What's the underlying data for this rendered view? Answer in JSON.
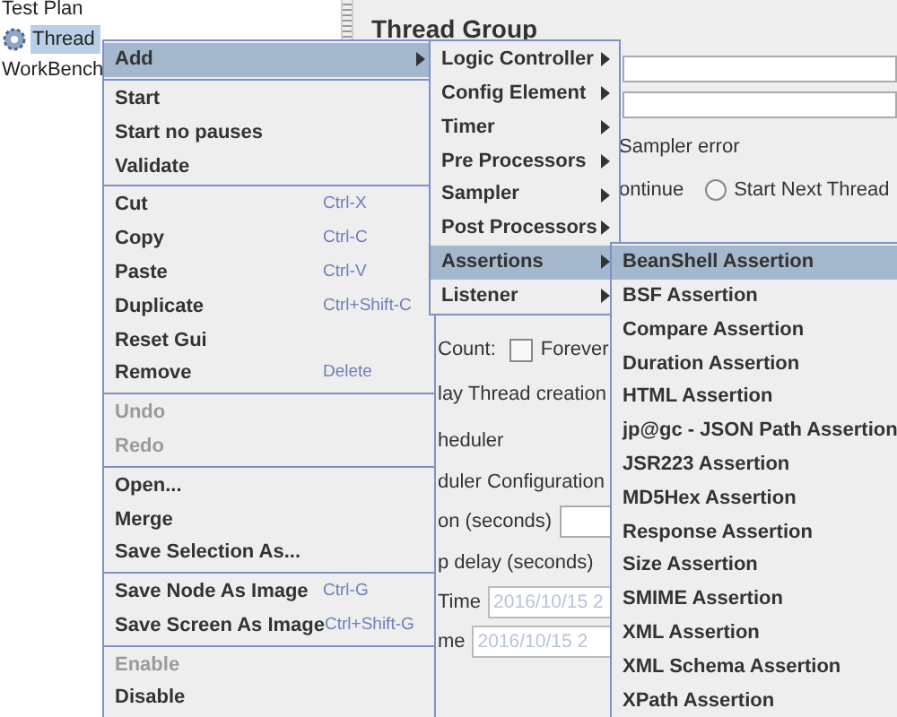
{
  "tree": [
    {
      "label": "Test Plan",
      "kind": "node",
      "selected": false
    },
    {
      "label": "Thread",
      "kind": "group",
      "selected": true
    },
    {
      "label": "WorkBench",
      "kind": "node",
      "selected": false
    }
  ],
  "panel": {
    "title": "Thread Group",
    "sampler_error": {
      "legend": "Sampler error",
      "continue_label": "ontinue",
      "options": [
        {
          "label": "Start Next Thread",
          "selected": false
        }
      ]
    },
    "rows": [
      {
        "kind": "checkbox",
        "label": "Count:",
        "option": "Forever",
        "checked": false
      },
      {
        "kind": "text",
        "label": "lay Thread creation"
      },
      {
        "kind": "text",
        "label": "heduler"
      },
      {
        "kind": "text",
        "label": "duler Configuration"
      },
      {
        "kind": "field",
        "label": "on (seconds)"
      },
      {
        "kind": "text",
        "label": "p delay (seconds)"
      },
      {
        "kind": "date",
        "label": "Time",
        "value": "2016/10/15 2"
      },
      {
        "kind": "date",
        "label": "me",
        "value": "2016/10/15 2"
      }
    ]
  },
  "context_menu": [
    {
      "kind": "item",
      "label": "Add",
      "submenu": true,
      "selected": true,
      "disabled": false
    },
    {
      "kind": "separator"
    },
    {
      "kind": "item",
      "label": "Start",
      "selected": false,
      "disabled": false
    },
    {
      "kind": "item",
      "label": "Start no pauses",
      "selected": false,
      "disabled": false
    },
    {
      "kind": "item",
      "label": "Validate",
      "selected": false,
      "disabled": false
    },
    {
      "kind": "separator"
    },
    {
      "kind": "item",
      "label": "Cut",
      "shortcut": "Ctrl-X",
      "selected": false,
      "disabled": false
    },
    {
      "kind": "item",
      "label": "Copy",
      "shortcut": "Ctrl-C",
      "selected": false,
      "disabled": false
    },
    {
      "kind": "item",
      "label": "Paste",
      "shortcut": "Ctrl-V",
      "selected": false,
      "disabled": false
    },
    {
      "kind": "item",
      "label": "Duplicate",
      "shortcut": "Ctrl+Shift-C",
      "selected": false,
      "disabled": false
    },
    {
      "kind": "item",
      "label": "Reset Gui",
      "selected": false,
      "disabled": false
    },
    {
      "kind": "item",
      "label": "Remove",
      "shortcut": "Delete",
      "selected": false,
      "disabled": false
    },
    {
      "kind": "separator"
    },
    {
      "kind": "item",
      "label": "Undo",
      "selected": false,
      "disabled": true
    },
    {
      "kind": "item",
      "label": "Redo",
      "selected": false,
      "disabled": true
    },
    {
      "kind": "separator"
    },
    {
      "kind": "item",
      "label": "Open...",
      "selected": false,
      "disabled": false
    },
    {
      "kind": "item",
      "label": "Merge",
      "selected": false,
      "disabled": false
    },
    {
      "kind": "item",
      "label": "Save Selection As...",
      "selected": false,
      "disabled": false
    },
    {
      "kind": "separator"
    },
    {
      "kind": "item",
      "label": "Save Node As Image",
      "shortcut": "Ctrl-G",
      "selected": false,
      "disabled": false
    },
    {
      "kind": "item",
      "label": "Save Screen As Image",
      "shortcut": "Ctrl+Shift-G",
      "selected": false,
      "disabled": false
    },
    {
      "kind": "separator"
    },
    {
      "kind": "item",
      "label": "Enable",
      "selected": false,
      "disabled": true
    },
    {
      "kind": "item",
      "label": "Disable",
      "selected": false,
      "disabled": false
    }
  ],
  "add_menu": [
    {
      "kind": "item",
      "label": "Logic Controller",
      "submenu": true,
      "selected": false
    },
    {
      "kind": "item",
      "label": "Config Element",
      "submenu": true,
      "selected": false
    },
    {
      "kind": "item",
      "label": "Timer",
      "submenu": true,
      "selected": false
    },
    {
      "kind": "item",
      "label": "Pre Processors",
      "submenu": true,
      "selected": false
    },
    {
      "kind": "item",
      "label": "Sampler",
      "submenu": true,
      "selected": false
    },
    {
      "kind": "item",
      "label": "Post Processors",
      "submenu": true,
      "selected": false
    },
    {
      "kind": "item",
      "label": "Assertions",
      "submenu": true,
      "selected": true
    },
    {
      "kind": "item",
      "label": "Listener",
      "submenu": true,
      "selected": false
    }
  ],
  "assertions_menu": [
    {
      "kind": "item",
      "label": "BeanShell Assertion",
      "selected": true
    },
    {
      "kind": "item",
      "label": "BSF Assertion",
      "selected": false
    },
    {
      "kind": "item",
      "label": "Compare Assertion",
      "selected": false
    },
    {
      "kind": "item",
      "label": "Duration Assertion",
      "selected": false
    },
    {
      "kind": "item",
      "label": "HTML Assertion",
      "selected": false
    },
    {
      "kind": "item",
      "label": "jp@gc - JSON Path Assertion",
      "selected": false
    },
    {
      "kind": "item",
      "label": "JSR223 Assertion",
      "selected": false
    },
    {
      "kind": "item",
      "label": "MD5Hex Assertion",
      "selected": false
    },
    {
      "kind": "item",
      "label": "Response Assertion",
      "selected": false
    },
    {
      "kind": "item",
      "label": "Size Assertion",
      "selected": false
    },
    {
      "kind": "item",
      "label": "SMIME Assertion",
      "selected": false
    },
    {
      "kind": "item",
      "label": "XML Assertion",
      "selected": false
    },
    {
      "kind": "item",
      "label": "XML Schema Assertion",
      "selected": false
    },
    {
      "kind": "item",
      "label": "XPath Assertion",
      "selected": false
    }
  ]
}
